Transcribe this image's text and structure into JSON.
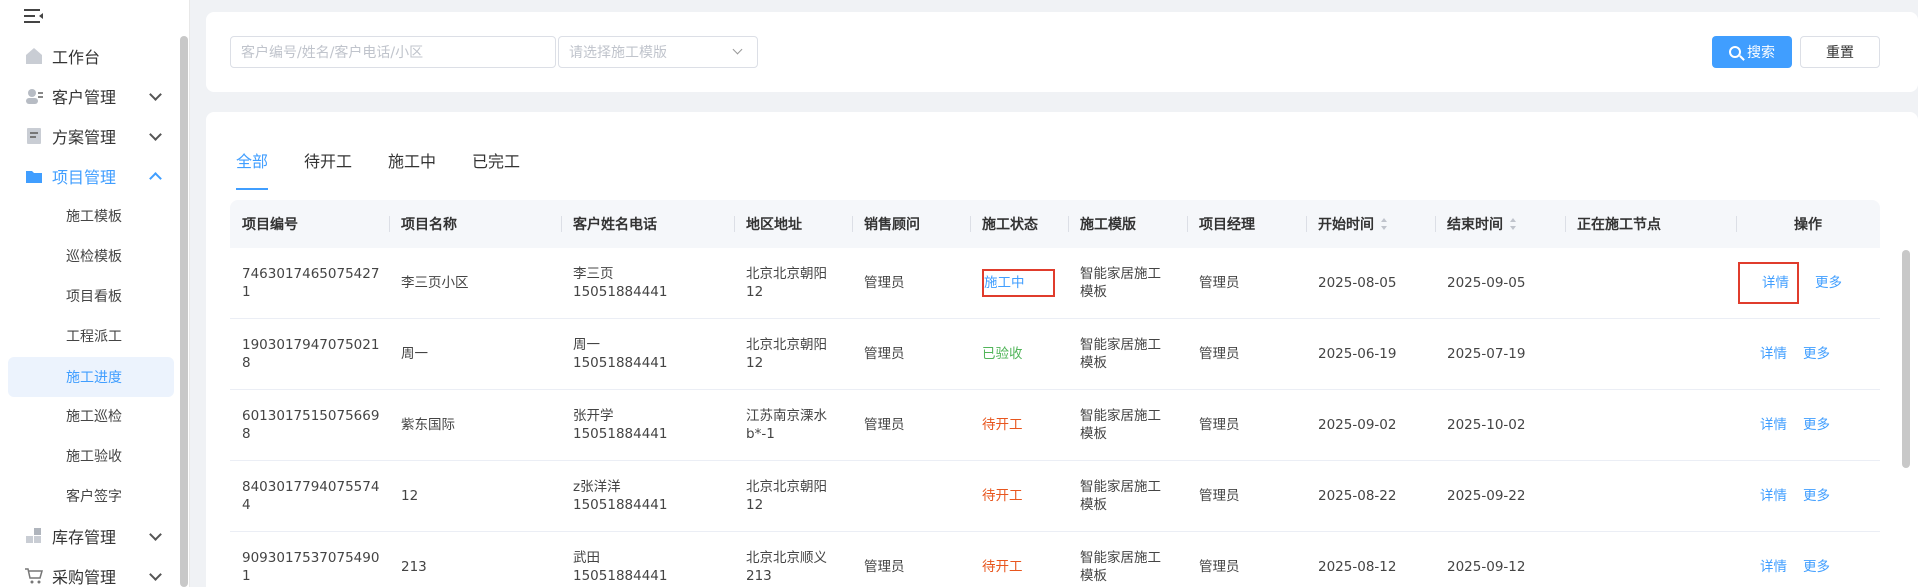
{
  "sidebar": {
    "items": [
      {
        "label": "工作台",
        "icon": "home-icon"
      },
      {
        "label": "客户管理",
        "icon": "customer-icon"
      },
      {
        "label": "方案管理",
        "icon": "document-icon"
      },
      {
        "label": "项目管理",
        "icon": "folder-icon"
      },
      {
        "label": "库存管理",
        "icon": "inventory-icon"
      },
      {
        "label": "采购管理",
        "icon": "cart-icon"
      }
    ],
    "sub_items": [
      "施工模板",
      "巡检模板",
      "项目看板",
      "工程派工",
      "施工进度",
      "施工巡检",
      "施工验收",
      "客户签字"
    ]
  },
  "search": {
    "keyword_placeholder": "客户编号/姓名/客户电话/小区",
    "template_placeholder": "请选择施工模版",
    "search_label": "搜索",
    "reset_label": "重置"
  },
  "tabs": [
    "全部",
    "待开工",
    "施工中",
    "已完工"
  ],
  "table": {
    "headers": [
      "项目编号",
      "项目名称",
      "客户姓名电话",
      "地区地址",
      "销售顾问",
      "施工状态",
      "施工模版",
      "项目经理",
      "开始时间",
      "结束时间",
      "正在施工节点",
      "操作"
    ],
    "rows": [
      {
        "id1": "7463017465075427",
        "id2": "1",
        "name": "李三页小区",
        "cust": "李三页",
        "phone": "15051884441",
        "addr1": "北京北京朝阳",
        "addr2": "12",
        "sales": "管理员",
        "status": "施工中",
        "tpl1": "智能家居施工",
        "tpl2": "模板",
        "manager": "管理员",
        "start": "2025-08-05",
        "end": "2025-09-05",
        "node": "",
        "detail": "详情",
        "more": "更多"
      },
      {
        "id1": "1903017947075021",
        "id2": "8",
        "name": "周一",
        "cust": "周一",
        "phone": "15051884441",
        "addr1": "北京北京朝阳",
        "addr2": "12",
        "sales": "管理员",
        "status": "已验收",
        "tpl1": "智能家居施工",
        "tpl2": "模板",
        "manager": "管理员",
        "start": "2025-06-19",
        "end": "2025-07-19",
        "node": "",
        "detail": "详情",
        "more": "更多"
      },
      {
        "id1": "6013017515075669",
        "id2": "8",
        "name": "紫东国际",
        "cust": "张开学",
        "phone": "15051884441",
        "addr1": "江苏南京溧水",
        "addr2": "b*-1",
        "sales": "管理员",
        "status": "待开工",
        "tpl1": "智能家居施工",
        "tpl2": "模板",
        "manager": "管理员",
        "start": "2025-09-02",
        "end": "2025-10-02",
        "node": "",
        "detail": "详情",
        "more": "更多"
      },
      {
        "id1": "8403017794075574",
        "id2": "4",
        "name": "12",
        "cust": "z张洋洋",
        "phone": "15051884441",
        "addr1": "北京北京朝阳",
        "addr2": "12",
        "sales": "",
        "status": "待开工",
        "tpl1": "智能家居施工",
        "tpl2": "模板",
        "manager": "管理员",
        "start": "2025-08-22",
        "end": "2025-09-22",
        "node": "",
        "detail": "详情",
        "more": "更多"
      },
      {
        "id1": "9093017537075490",
        "id2": "1",
        "name": "213",
        "cust": "武田",
        "phone": "15051884441",
        "addr1": "北京北京顺义",
        "addr2": "213",
        "sales": "管理员",
        "status": "待开工",
        "tpl1": "智能家居施工",
        "tpl2": "模板",
        "manager": "管理员",
        "start": "2025-08-12",
        "end": "2025-09-12",
        "node": "",
        "detail": "详情",
        "more": "更多"
      }
    ]
  },
  "colors": {
    "accent": "#409eff",
    "done": "#52b55a",
    "pending": "#e8561e",
    "highlight": "#e03c2c"
  }
}
